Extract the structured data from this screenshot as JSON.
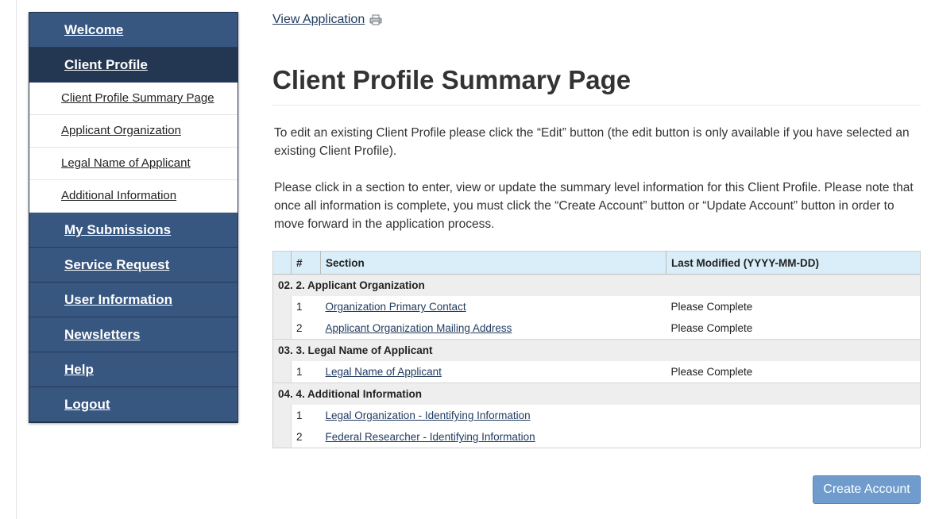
{
  "sidebar": {
    "items": [
      {
        "label": "Welcome"
      },
      {
        "label": "Client Profile"
      },
      {
        "label": "My Submissions"
      },
      {
        "label": "Service Request"
      },
      {
        "label": "User Information"
      },
      {
        "label": "Newsletters"
      },
      {
        "label": "Help"
      },
      {
        "label": "Logout"
      }
    ],
    "sub_items": [
      {
        "label": "Client Profile Summary Page"
      },
      {
        "label": "Applicant Organization"
      },
      {
        "label": "Legal Name of Applicant"
      },
      {
        "label": "Additional Information"
      }
    ]
  },
  "main": {
    "view_application": "View Application",
    "title": "Client Profile Summary Page",
    "paragraph1": "To edit an existing Client Profile please click the “Edit” button (the edit button is only available if you have selected an existing Client Profile).",
    "paragraph2": "Please click in a section to enter, view or update the summary level information for this Client Profile. Please note that once all information is complete, you must click the “Create Account” button or “Update Account” button in order to move forward in the application process."
  },
  "table": {
    "headers": {
      "num": "#",
      "section": "Section",
      "modified": "Last Modified (YYYY-MM-DD)"
    },
    "groups": [
      {
        "title": "02. 2. Applicant Organization",
        "rows": [
          {
            "num": "1",
            "section": "Organization Primary Contact",
            "modified": "Please Complete"
          },
          {
            "num": "2",
            "section": "Applicant Organization Mailing Address",
            "modified": "Please Complete"
          }
        ]
      },
      {
        "title": "03. 3. Legal Name of Applicant",
        "rows": [
          {
            "num": "1",
            "section": "Legal Name of Applicant",
            "modified": "Please Complete"
          }
        ]
      },
      {
        "title": "04. 4. Additional Information",
        "rows": [
          {
            "num": "1",
            "section": "Legal Organization - Identifying Information",
            "modified": ""
          },
          {
            "num": "2",
            "section": "Federal Researcher - Identifying Information",
            "modified": ""
          }
        ]
      }
    ]
  },
  "create_account_label": "Create Account",
  "colors": {
    "nav_bg": "#375680",
    "nav_active_bg": "#243752",
    "header_bg": "#d9eef8",
    "button_bg": "#6f9ccc"
  }
}
